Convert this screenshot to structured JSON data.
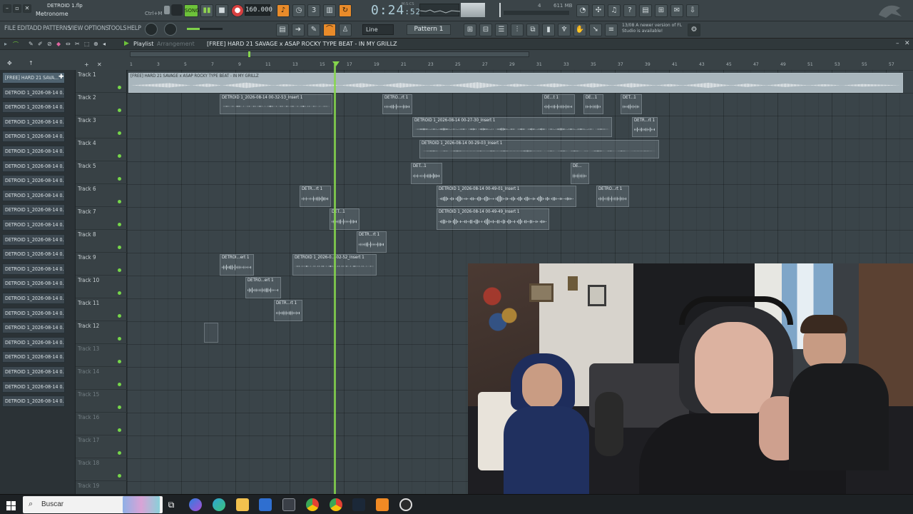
{
  "top": {
    "project_file": "DETROID 1.flp",
    "hint": "Metronome",
    "shortcut": "Ctrl+M",
    "song_mode": "SONG",
    "tempo": "160.000",
    "time_main": "0:24",
    "time_sub": "52",
    "time_unit": "M:S:CS",
    "memory": "611 MB",
    "cpu_small": "4",
    "voices": "2"
  },
  "menu": [
    "FILE",
    "EDIT",
    "ADD",
    "PATTERNS",
    "VIEW",
    "OPTIONS",
    "TOOLS",
    "HELP"
  ],
  "toolbar": {
    "snap": "Line",
    "pattern": "Pattern 1",
    "news_date": "13/08",
    "news_text": "A newer version of FL Studio is available!"
  },
  "playlist": {
    "label": "Playlist",
    "mode": "Arrangement",
    "title": "[FREE] HARD 21 SAVAGE x ASAP ROCKY TYPE BEAT - IN MY GRILLZ"
  },
  "ruler_ticks": [
    "1",
    "3",
    "5",
    "7",
    "9",
    "11",
    "13",
    "15",
    "17",
    "19",
    "21",
    "23",
    "25",
    "27",
    "29",
    "31",
    "33",
    "35",
    "37",
    "39",
    "41",
    "43",
    "45",
    "47",
    "49",
    "51",
    "53",
    "55",
    "57"
  ],
  "patterns": [
    "[FREE] HARD 21 SAVA...",
    "DETROID 1_2026-08-14 0...",
    "DETROID 1_2026-08-14 0...",
    "DETROID 1_2026-08-14 0...",
    "DETROID 1_2026-08-14 0...",
    "DETROID 1_2026-08-14 0...",
    "DETROID 1_2026-08-14 0...",
    "DETROID 1_2026-08-14 0...",
    "DETROID 1_2026-08-14 0...",
    "DETROID 1_2026-08-14 0...",
    "DETROID 1_2026-08-14 0...",
    "DETROID 1_2026-08-14 0...",
    "DETROID 1_2026-08-14 0...",
    "DETROID 1_2026-08-14 0...",
    "DETROID 1_2026-08-14 0...",
    "DETROID 1_2026-08-14 0...",
    "DETROID 1_2026-08-14 0...",
    "DETROID 1_2026-08-14 0...",
    "DETROID 1_2026-08-14 0...",
    "DETROID 1_2026-08-14 0...",
    "DETROID 1_2026-08-14 0...",
    "DETROID 1_2026-08-14 0...",
    "DETROID 1_2026-08-14 0..."
  ],
  "tracks": [
    "Track 1",
    "Track 2",
    "Track 3",
    "Track 4",
    "Track 5",
    "Track 6",
    "Track 7",
    "Track 8",
    "Track 9",
    "Track 10",
    "Track 11",
    "Track 12",
    "Track 13",
    "Track 14",
    "Track 15",
    "Track 16",
    "Track 17",
    "Track 18",
    "Track 19"
  ],
  "clips": {
    "c1": "[FREE] HARD 21 SAVAGE x ASAP ROCKY TYPE BEAT - IN MY GRILLZ",
    "c2": "DETROID 1_2026-08-14 00-32-53_Insert 1",
    "c3": "DETRO...rt 1",
    "c4": "DE...t 1",
    "c5": "DE...1",
    "c6": "DET...1",
    "c7": "DETROID 1_2026-08-14 00-27-30_Insert 1",
    "c8": "DETR...rt 1",
    "c9": "DETROID 1_2026-08-14 00-29-03_Insert 1",
    "c10": "DET...1",
    "c11": "DE...",
    "c12": "DETR...rt 1",
    "c13": "DETROID 1_2026-08-14 00-49-01_Insert 1",
    "c14": "DETRO...rt 1",
    "c15": "DET...1",
    "c16": "DETROID 1_2026-08-14 00-49-49_Insert 1",
    "c17": "DETR...rt 1",
    "c18": "DETROI...ert 1",
    "c19": "DETROID 1_2026-0...-02-52_Insert 1",
    "c20": "DETRO...ert 1",
    "c21": "DETR...rt 1"
  },
  "taskbar": {
    "search_placeholder": "Buscar"
  }
}
